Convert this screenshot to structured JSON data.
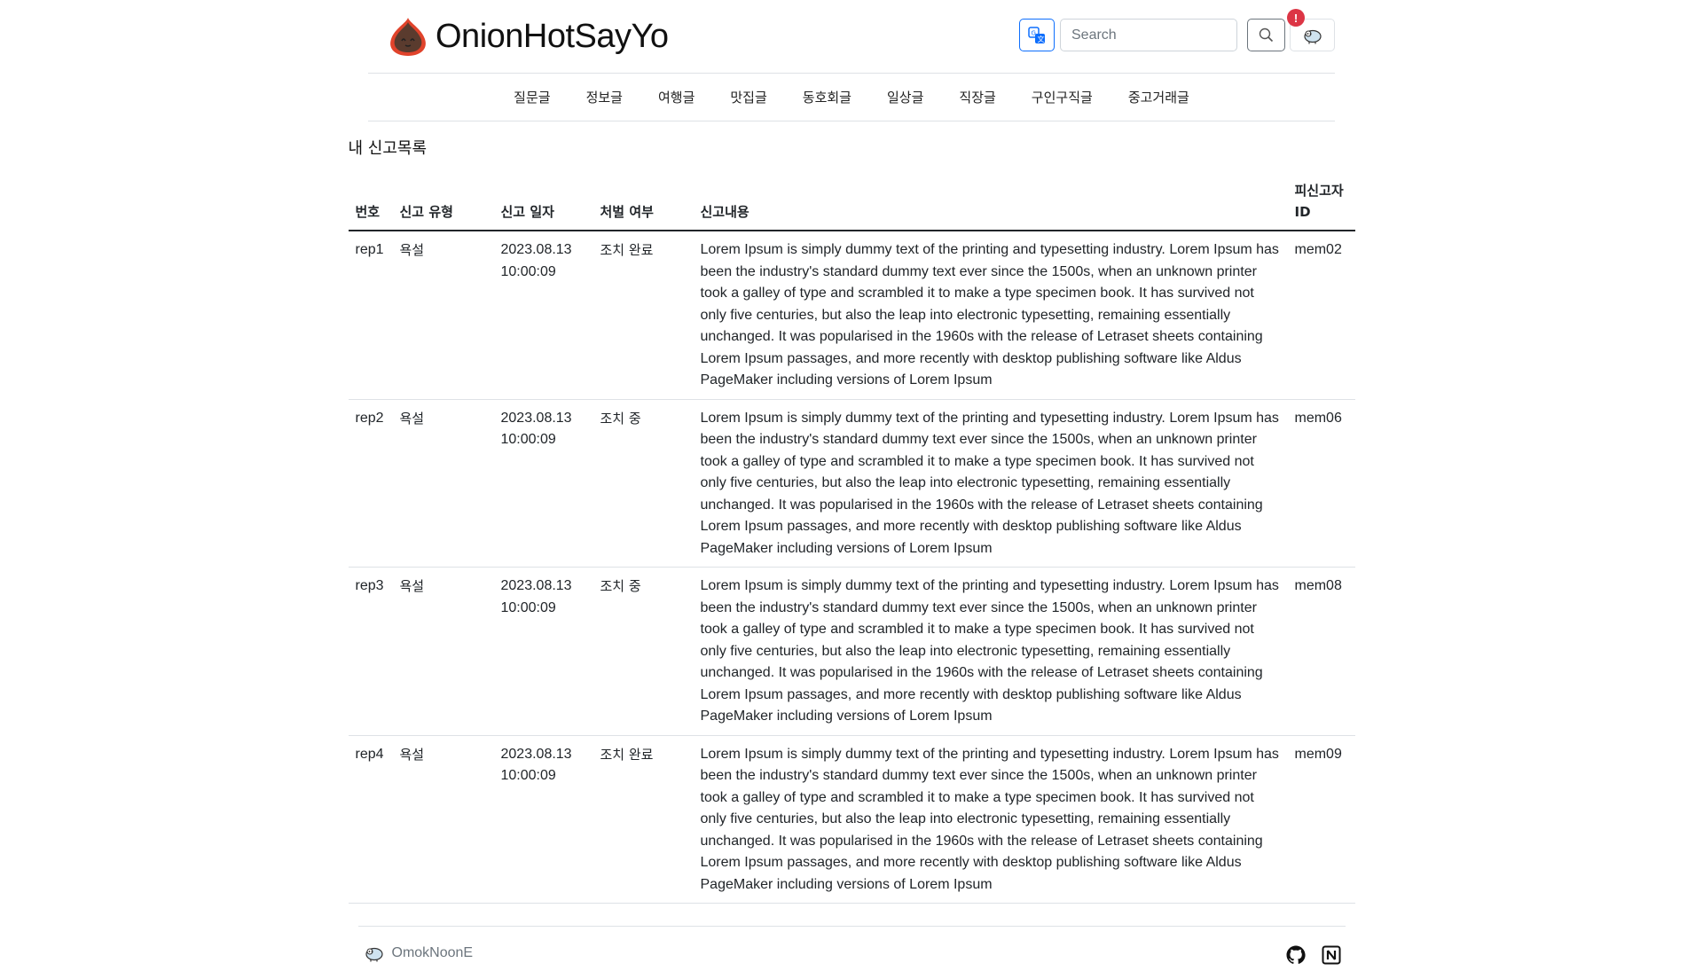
{
  "header": {
    "brand": "OnionHotSayYo",
    "search_placeholder": "Search",
    "search_value": "",
    "alert_badge": "!"
  },
  "nav": {
    "items": [
      "질문글",
      "정보글",
      "여행글",
      "맛집글",
      "동호회글",
      "일상글",
      "직장글",
      "구인구직글",
      "중고거래글"
    ]
  },
  "page": {
    "title": "내 신고목록"
  },
  "table": {
    "headers": [
      "번호",
      "신고 유형",
      "신고 일자",
      "처벌 여부",
      "신고내용",
      "피신고자 ID"
    ],
    "rows": [
      {
        "num": "rep1",
        "type": "욕설",
        "date": "2023.08.13 10:00:09",
        "status": "조치 완료",
        "content": "Lorem Ipsum is simply dummy text of the printing and typesetting industry. Lorem Ipsum has been the industry's standard dummy text ever since the 1500s, when an unknown printer took a galley of type and scrambled it to make a type specimen book. It has survived not only five centuries, but also the leap into electronic typesetting, remaining essentially unchanged. It was popularised in the 1960s with the release of Letraset sheets containing Lorem Ipsum passages, and more recently with desktop publishing software like Aldus PageMaker including versions of Lorem Ipsum",
        "target": "mem02"
      },
      {
        "num": "rep2",
        "type": "욕설",
        "date": "2023.08.13 10:00:09",
        "status": "조치 중",
        "content": "Lorem Ipsum is simply dummy text of the printing and typesetting industry. Lorem Ipsum has been the industry's standard dummy text ever since the 1500s, when an unknown printer took a galley of type and scrambled it to make a type specimen book. It has survived not only five centuries, but also the leap into electronic typesetting, remaining essentially unchanged. It was popularised in the 1960s with the release of Letraset sheets containing Lorem Ipsum passages, and more recently with desktop publishing software like Aldus PageMaker including versions of Lorem Ipsum",
        "target": "mem06"
      },
      {
        "num": "rep3",
        "type": "욕설",
        "date": "2023.08.13 10:00:09",
        "status": "조치 중",
        "content": "Lorem Ipsum is simply dummy text of the printing and typesetting industry. Lorem Ipsum has been the industry's standard dummy text ever since the 1500s, when an unknown printer took a galley of type and scrambled it to make a type specimen book. It has survived not only five centuries, but also the leap into electronic typesetting, remaining essentially unchanged. It was popularised in the 1960s with the release of Letraset sheets containing Lorem Ipsum passages, and more recently with desktop publishing software like Aldus PageMaker including versions of Lorem Ipsum",
        "target": "mem08"
      },
      {
        "num": "rep4",
        "type": "욕설",
        "date": "2023.08.13 10:00:09",
        "status": "조치 완료",
        "content": "Lorem Ipsum is simply dummy text of the printing and typesetting industry. Lorem Ipsum has been the industry's standard dummy text ever since the 1500s, when an unknown printer took a galley of type and scrambled it to make a type specimen book. It has survived not only five centuries, but also the leap into electronic typesetting, remaining essentially unchanged. It was popularised in the 1960s with the release of Letraset sheets containing Lorem Ipsum passages, and more recently with desktop publishing software like Aldus PageMaker including versions of Lorem Ipsum",
        "target": "mem09"
      }
    ]
  },
  "footer": {
    "name": "OmokNoonE"
  },
  "colors": {
    "primary": "#0d6efd",
    "danger": "#dc3545",
    "border": "#dee2e6",
    "logo_red": "#e0432b",
    "logo_brown": "#5a3b2e"
  },
  "icons": {
    "brand_logo": "onion-logo-icon",
    "translate": "translate-icon",
    "search": "search-icon",
    "profile": "sheep-avatar-icon",
    "github": "github-icon",
    "notion": "notion-icon"
  }
}
